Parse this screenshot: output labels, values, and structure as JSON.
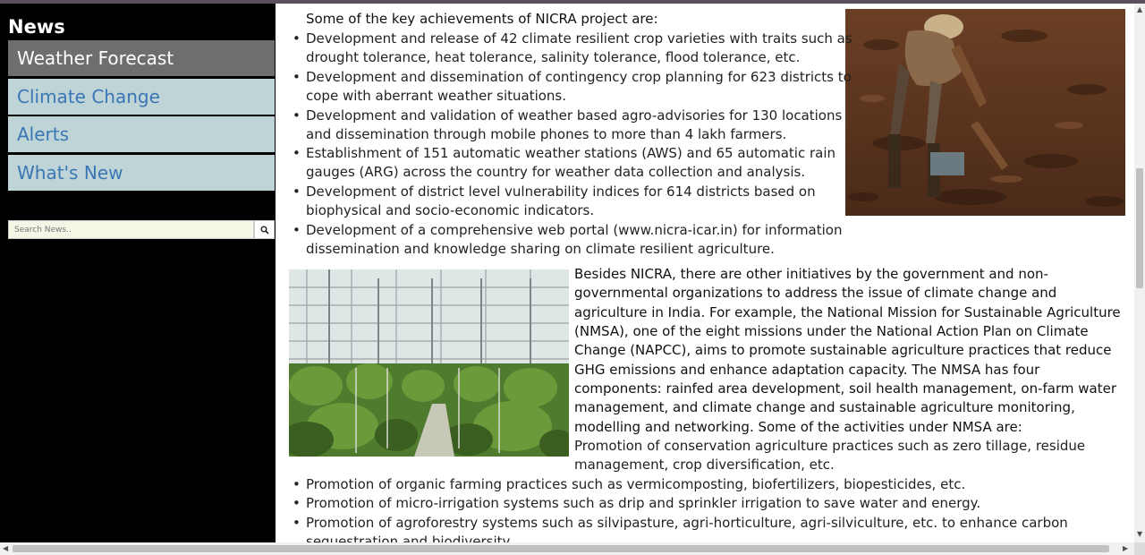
{
  "sidebar": {
    "heading": "News",
    "nav": [
      {
        "label": "Weather Forecast",
        "active": true
      },
      {
        "label": "Climate Change",
        "active": false
      },
      {
        "label": "Alerts",
        "active": false
      },
      {
        "label": "What's New",
        "active": false
      }
    ],
    "search": {
      "placeholder": "Search News..",
      "icon": "search-icon"
    }
  },
  "content": {
    "intro": "Some of the key achievements of NICRA project are:",
    "achievements": [
      [
        "Development and release of 42 climate resilient crop varieties with traits such as",
        "drought tolerance, heat tolerance, salinity tolerance, flood tolerance, etc."
      ],
      [
        "Development and dissemination of contingency crop planning for 623 districts to",
        "cope with aberrant weather situations."
      ],
      [
        "Development and validation of weather based agro-advisories for 130 locations",
        "and dissemination through mobile phones to more than 4 lakh farmers."
      ],
      [
        "Establishment of 151 automatic weather stations (AWS) and 65 automatic rain",
        "gauges (ARG) across the country for weather data collection and analysis."
      ],
      [
        "Development of district level vulnerability indices for 614 districts based on",
        "biophysical and socio-economic indicators."
      ],
      [
        "Development of a comprehensive web portal (www.nicra-icar.in) for information",
        "dissemination and knowledge sharing on climate resilient agriculture."
      ]
    ],
    "nmsa_paragraph": [
      "Besides NICRA, there are other initiatives by the government and non-",
      "governmental organizations to address the issue of climate change and",
      "agriculture in India. For example, the National Mission for Sustainable Agriculture",
      "(NMSA), one of the eight missions under the National Action Plan on Climate",
      "Change (NAPCC), aims to promote sustainable agriculture practices that reduce",
      "GHG emissions and enhance adaptation capacity. The NMSA has four",
      "components: rainfed area development, soil health management, on-farm water",
      "management, and climate change and sustainable agriculture monitoring,",
      "modelling and networking. Some of the activities under NMSA are:"
    ],
    "conservation_lines": [
      "Promotion of conservation agriculture practices such as zero tillage, residue",
      "management, crop diversification, etc."
    ],
    "activities": [
      "Promotion of organic farming practices such as vermicomposting, biofertilizers, biopesticides, etc.",
      "Promotion of micro-irrigation systems such as drip and sprinkler irrigation to save water and energy.",
      "Promotion of agroforestry systems such as silvipasture, agri-horticulture, agri-silviculture, etc. to enhance carbon",
      "sequestration and biodiversity."
    ]
  },
  "colors": {
    "sidebar_bg": "#000000",
    "active_nav_bg": "#6e6f6c",
    "inactive_nav_bg": "#bfd4d7",
    "link_blue": "#3a76b5"
  }
}
